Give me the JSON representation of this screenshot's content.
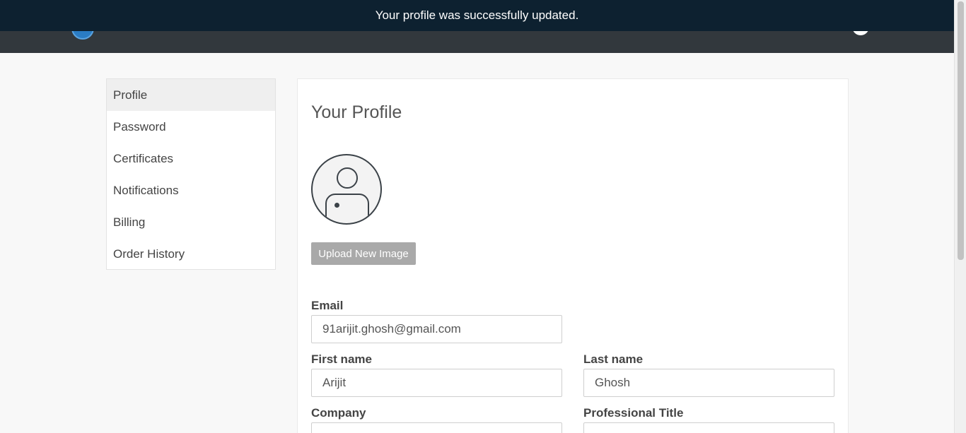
{
  "banner": {
    "message": "Your profile was successfully updated."
  },
  "navbar": {
    "logo_icon": "logo-icon",
    "avatar_icon": "user-avatar-icon"
  },
  "sidebar": {
    "items": [
      {
        "label": "Profile",
        "active": true
      },
      {
        "label": "Password"
      },
      {
        "label": "Certificates"
      },
      {
        "label": "Notifications"
      },
      {
        "label": "Billing"
      },
      {
        "label": "Order History"
      }
    ]
  },
  "profile": {
    "title": "Your Profile",
    "upload_label": "Upload New Image",
    "avatar_icon": "user-silhouette-icon",
    "fields": {
      "email": {
        "label": "Email",
        "value": "91arijit.ghosh@gmail.com"
      },
      "first_name": {
        "label": "First name",
        "value": "Arijit"
      },
      "last_name": {
        "label": "Last name",
        "value": "Ghosh"
      },
      "company": {
        "label": "Company",
        "value": ""
      },
      "professional_title": {
        "label": "Professional Title",
        "value": ""
      }
    }
  },
  "colors": {
    "banner_bg": "#0d2130",
    "navbar_bg": "#32383d",
    "upload_btn_bg": "#a9a9a9"
  }
}
